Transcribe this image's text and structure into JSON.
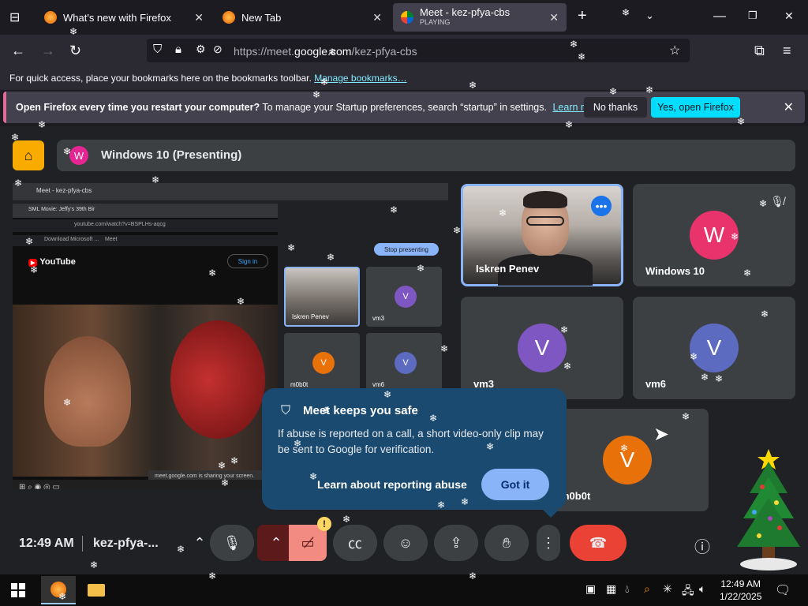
{
  "browser": {
    "tabs": [
      {
        "title": "What's new with Firefox",
        "favicon": "firefox-icon"
      },
      {
        "title": "New Tab",
        "favicon": "firefox-icon"
      },
      {
        "title": "Meet - kez-pfya-cbs",
        "subtitle": "PLAYING",
        "favicon": "google-meet-icon",
        "active": true
      }
    ],
    "new_tab_label": "+",
    "url_prefix": "https://meet.",
    "url_host": "google.com",
    "url_path": "/kez-pfya-cbs",
    "bookmarks_text": "For quick access, place your bookmarks here on the bookmarks toolbar.",
    "bookmarks_link": "Manage bookmarks…",
    "notification": {
      "bold": "Open Firefox every time you restart your computer?",
      "text": "To manage your Startup preferences, search “startup” in settings.",
      "link": "Learn more",
      "no_label": "No thanks",
      "yes_label": "Yes, open Firefox"
    }
  },
  "meet": {
    "presenting_avatar": "W",
    "presenting_title": "Windows 10 (Presenting)",
    "shared_screen": {
      "chrome_tab": "Meet - kez-pfya-cbs",
      "yt_tab": "SML Movie: Jeffy's 39th Bir",
      "yt_url": "youtube.com/watch?v=BSPLHs-aqcg",
      "bookmark1": "Download Microsoft ...",
      "bookmark2": "Meet",
      "yt_logo": "YouTube",
      "yt_signin": "Sign in",
      "stop_presenting": "Stop presenting",
      "sharing_text": "meet.google.com is sharing your screen.",
      "mini_tiles": [
        {
          "name": "Iskren Penev",
          "initial": ""
        },
        {
          "name": "vm3",
          "initial": "V"
        },
        {
          "name": "m0b0t",
          "initial": "V"
        },
        {
          "name": "vm6",
          "initial": "V"
        }
      ]
    },
    "participants": [
      {
        "name": "Iskren Penev",
        "initial": ""
      },
      {
        "name": "Windows 10",
        "initial": "W"
      },
      {
        "name": "vm3",
        "initial": "V"
      },
      {
        "name": "vm6",
        "initial": "V"
      },
      {
        "name": "m0b0t",
        "initial": "V"
      }
    ],
    "popup": {
      "title": "Meet keeps you safe",
      "body": "If abuse is reported on a call, a short video-only clip may be sent to Google for verification.",
      "link": "Learn about reporting abuse",
      "button": "Got it"
    },
    "controls": {
      "time": "12:49 AM",
      "meeting_code": "kez-pfya-...",
      "warning": "!"
    },
    "colors": {
      "bg": "#202124",
      "tile": "#3c4043",
      "accent": "#8ab4f8",
      "hangup": "#ea4335",
      "popup": "#1a4a70"
    }
  },
  "taskbar": {
    "time": "12:49 AM",
    "date": "1/22/2025"
  }
}
